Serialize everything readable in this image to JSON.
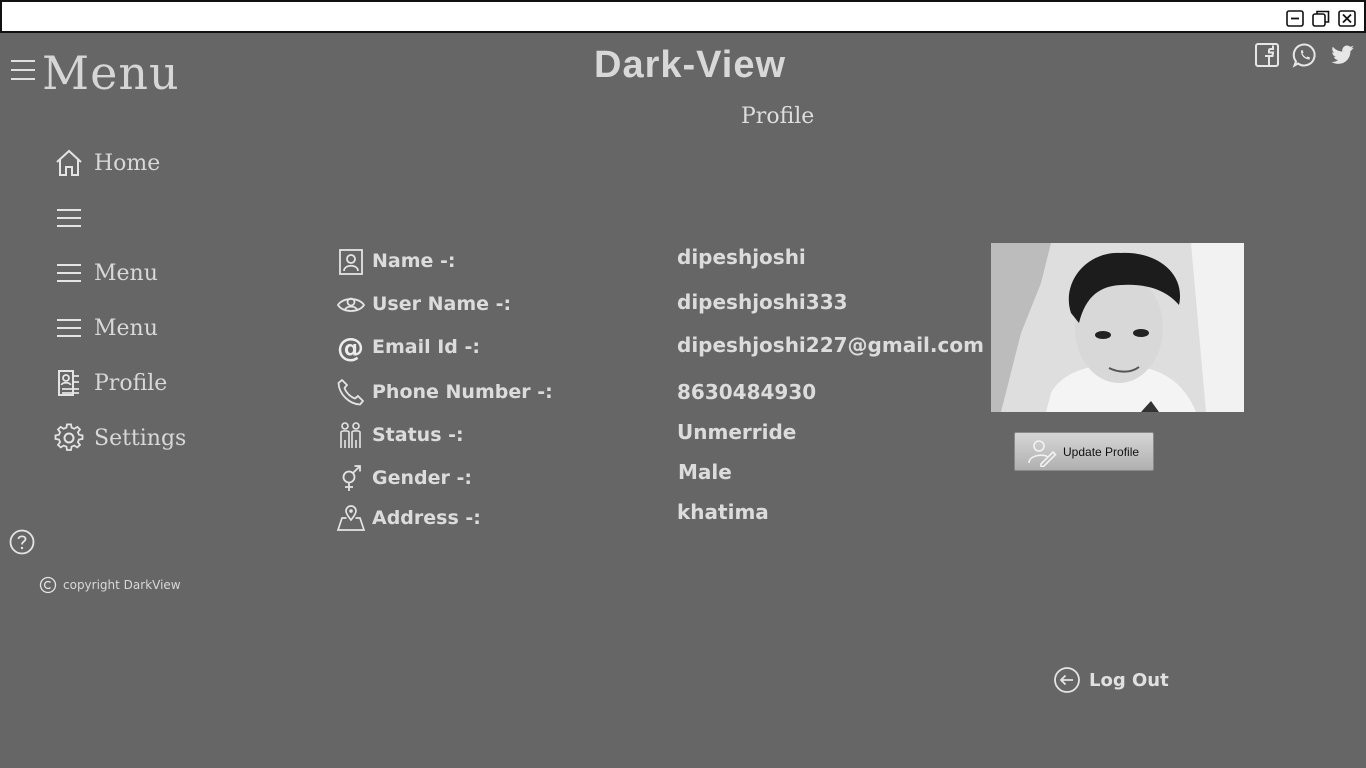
{
  "header": {
    "menu_title": "Menu",
    "brand": "Dark-View",
    "page_heading": "Profile"
  },
  "window_controls": [
    "minimize-icon",
    "restore-icon",
    "close-icon"
  ],
  "social": [
    "facebook-icon",
    "whatsapp-icon",
    "twitter-icon"
  ],
  "sidebar": {
    "items": [
      {
        "label": "Home",
        "icon": "home-icon"
      },
      {
        "label": "",
        "icon": "hamburger-icon"
      },
      {
        "label": "Menu",
        "icon": "hamburger-icon"
      },
      {
        "label": "Menu",
        "icon": "hamburger-icon"
      },
      {
        "label": "Profile",
        "icon": "profile-card-icon"
      },
      {
        "label": "Settings",
        "icon": "gear-icon"
      }
    ],
    "copyright": "copyright DarkView"
  },
  "profile": {
    "fields": [
      {
        "label": "Name -:",
        "value": "dipeshjoshi",
        "icon": "contact-icon"
      },
      {
        "label": "User Name -:",
        "value": "dipeshjoshi333",
        "icon": "user-eye-icon"
      },
      {
        "label": "Email Id -:",
        "value": "dipeshjoshi227@gmail.com",
        "icon": "at-icon"
      },
      {
        "label": "Phone Number -:",
        "value": "8630484930",
        "icon": "phone-icon"
      },
      {
        "label": "Status -:",
        "value": "Unmerride",
        "icon": "family-icon"
      },
      {
        "label": "Gender -:",
        "value": "Male",
        "icon": "gender-icon"
      },
      {
        "label": "Address -:",
        "value": "khatima",
        "icon": "map-pin-icon"
      }
    ],
    "update_button": "Update Profile"
  },
  "logout_label": "Log Out",
  "colors": {
    "background": "#666666",
    "text": "#dcdcdc",
    "titlebar": "#ffffff"
  }
}
